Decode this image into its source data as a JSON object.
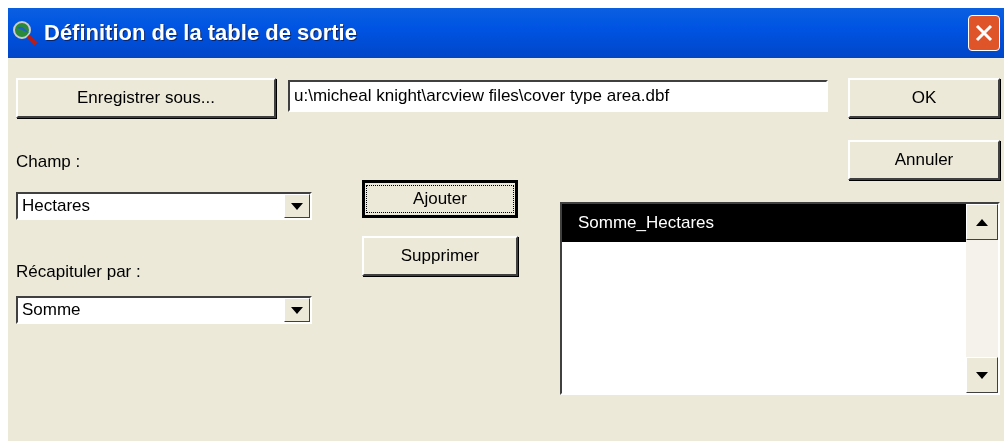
{
  "window": {
    "title": "Définition de la table de sortie"
  },
  "save_as_button": {
    "label": "Enregistrer sous..."
  },
  "output_path": {
    "value": "u:\\micheal knight\\arcview files\\cover type area.dbf"
  },
  "ok_button": {
    "label": "OK"
  },
  "cancel_button": {
    "label": "Annuler"
  },
  "field": {
    "label": "Champ :",
    "value": "Hectares"
  },
  "summarize": {
    "label": "Récapituler par :",
    "value": "Somme"
  },
  "add_button": {
    "label": "Ajouter",
    "focused": true
  },
  "remove_button": {
    "label": "Supprimer",
    "focused": false
  },
  "output_fields": [
    {
      "label": "Somme_Hectares",
      "selected": true
    }
  ]
}
